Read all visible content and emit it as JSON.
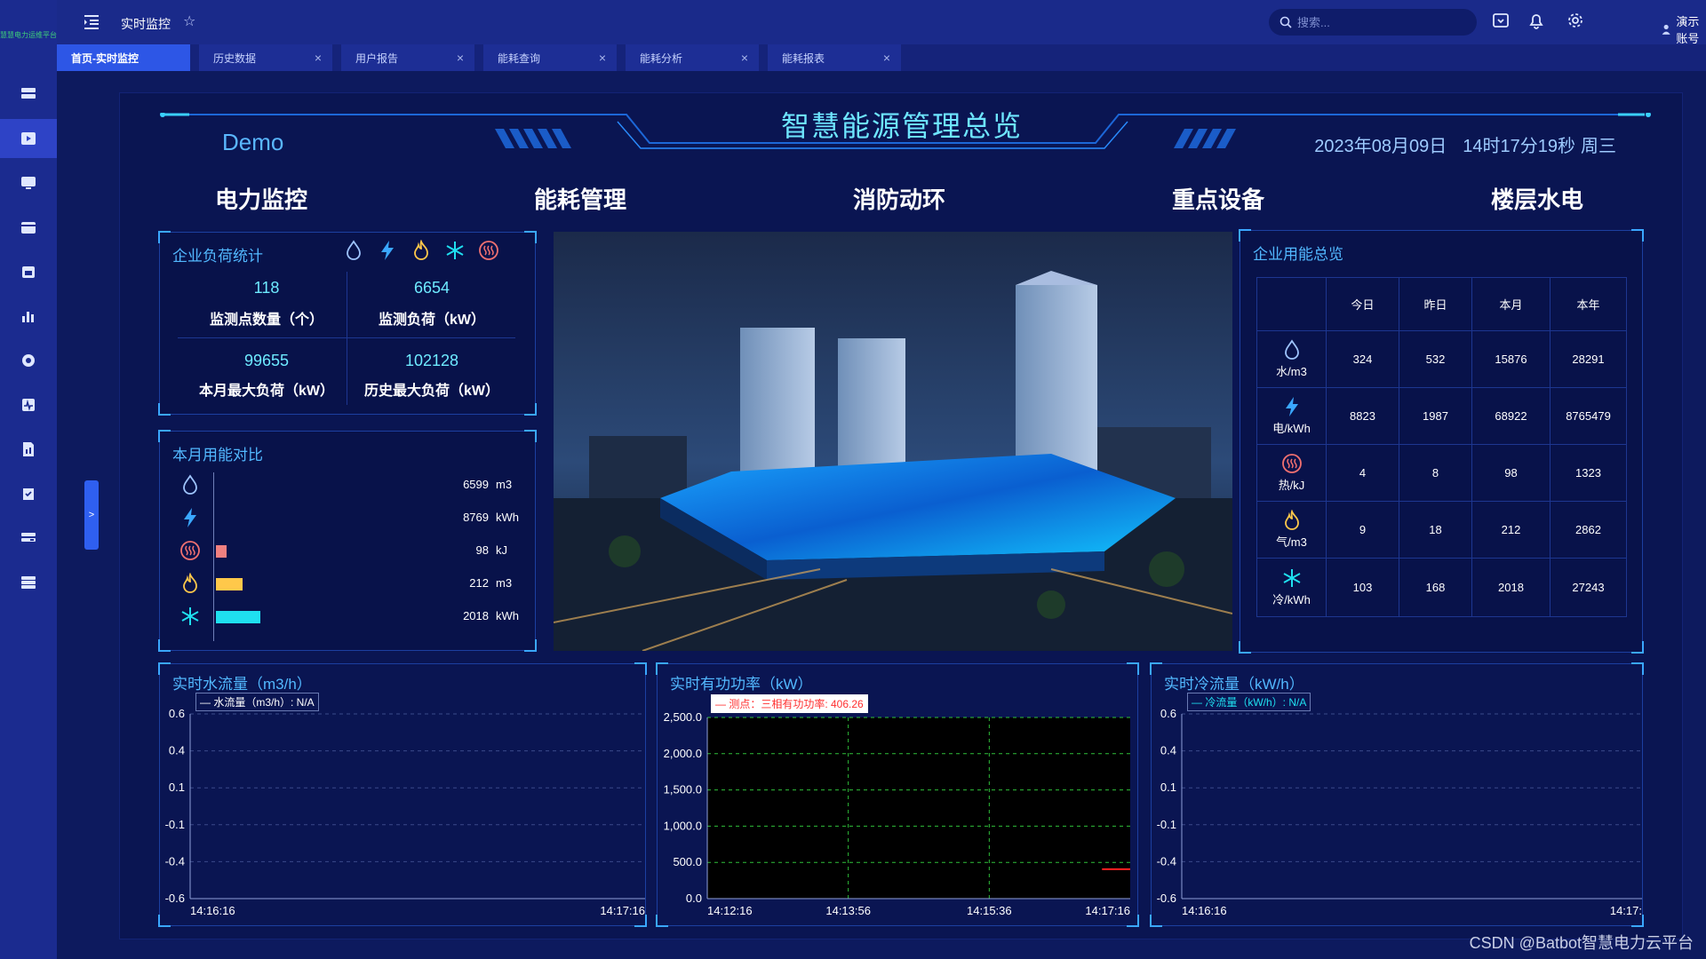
{
  "brand": "慧慧电力运维平台",
  "header": {
    "page_title": "实时监控",
    "search_placeholder": "搜索...",
    "user_name": "演示账号"
  },
  "tabs": [
    {
      "label": "首页-实时监控",
      "active": true
    },
    {
      "label": "历史数据",
      "closable": true
    },
    {
      "label": "用户报告",
      "closable": true
    },
    {
      "label": "能耗查询",
      "closable": true
    },
    {
      "label": "能耗分析",
      "closable": true
    },
    {
      "label": "能耗报表",
      "closable": true
    }
  ],
  "dashboard": {
    "title": "智慧能源管理总览",
    "demo_label": "Demo",
    "date": "2023年08月09日",
    "time": "14时17分19秒",
    "weekday": "周三",
    "nav": [
      "电力监控",
      "能耗管理",
      "消防动环",
      "重点设备",
      "楼层水电"
    ]
  },
  "load_stats": {
    "title": "企业负荷统计",
    "icons": [
      "water-icon",
      "electric-icon",
      "gas-icon",
      "cold-icon",
      "heat-icon"
    ],
    "items": [
      {
        "value": "118",
        "label": "监测点数量（个）"
      },
      {
        "value": "6654",
        "label": "监测负荷（kW）"
      },
      {
        "value": "99655",
        "label": "本月最大负荷（kW）"
      },
      {
        "value": "102128",
        "label": "历史最大负荷（kW）"
      }
    ]
  },
  "monthly_compare": {
    "title": "本月用能对比",
    "rows": [
      {
        "icon": "water-icon",
        "value": "6599",
        "unit": "m3",
        "fraction": 0.0,
        "color": "#5bb0ff"
      },
      {
        "icon": "electric-icon",
        "value": "8769",
        "unit": "kWh",
        "fraction": 0.0,
        "color": "#3aa7ff"
      },
      {
        "icon": "heat-icon",
        "value": "98",
        "unit": "kJ",
        "fraction": 0.12,
        "color": "#f08080"
      },
      {
        "icon": "gas-icon",
        "value": "212",
        "unit": "m3",
        "fraction": 0.3,
        "color": "#ffc84a"
      },
      {
        "icon": "cold-icon",
        "value": "2018",
        "unit": "kWh",
        "fraction": 0.5,
        "color": "#1fe0f0"
      }
    ]
  },
  "overview": {
    "title": "企业用能总览",
    "columns": [
      "今日",
      "昨日",
      "本月",
      "本年"
    ],
    "rows": [
      {
        "icon": "water-icon",
        "label": "水/m3",
        "values": [
          "324",
          "532",
          "15876",
          "28291"
        ]
      },
      {
        "icon": "electric-icon",
        "label": "电/kWh",
        "values": [
          "8823",
          "1987",
          "68922",
          "8765479"
        ]
      },
      {
        "icon": "heat-icon",
        "label": "热/kJ",
        "values": [
          "4",
          "8",
          "98",
          "1323"
        ]
      },
      {
        "icon": "gas-icon",
        "label": "气/m3",
        "values": [
          "9",
          "18",
          "212",
          "2862"
        ]
      },
      {
        "icon": "cold-icon",
        "label": "冷/kWh",
        "values": [
          "103",
          "168",
          "2018",
          "27243"
        ]
      }
    ]
  },
  "charts": {
    "water": {
      "title": "实时水流量（m3/h）",
      "legend": "— 水流量（m3/h）: N/A",
      "x_start": "14:16:16",
      "x_end": "14:17:16"
    },
    "power": {
      "title": "实时有功功率（kW）",
      "legend": "— 测点：三相有功功率: 406.26",
      "x_ticks": [
        "14:12:16",
        "14:13:56",
        "14:15:36",
        "14:17:16"
      ]
    },
    "cold": {
      "title": "实时冷流量（kW/h）",
      "legend": "— 冷流量（kW/h）: N/A",
      "x_start": "14:16:16",
      "x_end": "14:17:"
    }
  },
  "chart_data": [
    {
      "type": "line",
      "title": "实时水流量（m3/h）",
      "series": [
        {
          "name": "水流量（m3/h）",
          "values": []
        }
      ],
      "yticks": [
        "0.6",
        "0.4",
        "0.1",
        "-0.1",
        "-0.4",
        "-0.6"
      ],
      "ylim": [
        -0.6,
        0.6
      ],
      "xticks": [
        "14:16:16",
        "14:17:16"
      ]
    },
    {
      "type": "line",
      "title": "实时有功功率（kW）",
      "series": [
        {
          "name": "测点：三相有功功率",
          "x": [
            "14:16:56",
            "14:17:16"
          ],
          "values": [
            406.26,
            406.26
          ],
          "color": "#ff2020"
        }
      ],
      "yticks": [
        "2,500.0",
        "2,000.0",
        "1,500.0",
        "1,000.0",
        "500.0",
        "0.0"
      ],
      "ylim": [
        0,
        2500
      ],
      "xticks": [
        "14:12:16",
        "14:13:56",
        "14:15:36",
        "14:17:16"
      ]
    },
    {
      "type": "line",
      "title": "实时冷流量（kW/h）",
      "series": [
        {
          "name": "冷流量（kW/h）",
          "values": []
        }
      ],
      "yticks": [
        "0.6",
        "0.4",
        "0.1",
        "-0.1",
        "-0.4",
        "-0.6"
      ],
      "ylim": [
        -0.6,
        0.6
      ],
      "xticks": [
        "14:16:16",
        "14:17:"
      ]
    }
  ],
  "watermark": "CSDN @Batbot智慧电力云平台",
  "collapse_label": ">"
}
